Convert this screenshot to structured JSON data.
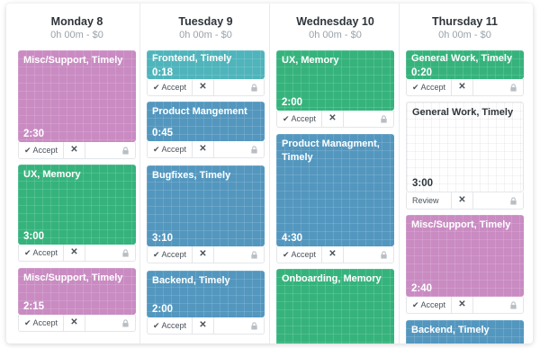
{
  "days": [
    {
      "title": "Monday 8",
      "summary": "0h 00m - $0",
      "entries": [
        {
          "label": "Misc/Support, Timely",
          "duration": "2:30",
          "color": "pink",
          "action": "Accept"
        },
        {
          "label": "UX, Memory",
          "duration": "3:00",
          "color": "green",
          "action": "Accept"
        },
        {
          "label": "Misc/Support, Timely",
          "duration": "2:15",
          "color": "pink",
          "action": "Accept"
        }
      ]
    },
    {
      "title": "Tuesday 9",
      "summary": "0h 00m - $0",
      "entries": [
        {
          "label": "Frontend, Timely",
          "duration": "0:18",
          "color": "teal",
          "action": "Accept"
        },
        {
          "label": "Product Mangement",
          "duration": "0:45",
          "color": "blue",
          "action": "Accept"
        },
        {
          "label": "Bugfixes, Timely",
          "duration": "3:10",
          "color": "blue",
          "action": "Accept"
        },
        {
          "label": "Backend, Timely",
          "duration": "2:00",
          "color": "blue",
          "action": "Accept"
        }
      ]
    },
    {
      "title": "Wednesday 10",
      "summary": "0h 00m - $0",
      "entries": [
        {
          "label": "UX, Memory",
          "duration": "2:00",
          "color": "green",
          "action": "Accept"
        },
        {
          "label": "Product Managment, Timely",
          "duration": "4:30",
          "color": "blue",
          "action": "Accept"
        },
        {
          "label": "Onboarding, Memory",
          "duration": "",
          "color": "green",
          "action": ""
        }
      ]
    },
    {
      "title": "Thursday 11",
      "summary": "0h 00m - $0",
      "entries": [
        {
          "label": "General Work, Timely",
          "duration": "0:20",
          "color": "green",
          "action": "Accept"
        },
        {
          "label": "General Work, Timely",
          "duration": "3:00",
          "color": "white",
          "action": "Review"
        },
        {
          "label": "Misc/Support, Timely",
          "duration": "2:40",
          "color": "pink",
          "action": "Accept"
        },
        {
          "label": "Backend, Timely",
          "duration": "",
          "color": "blue",
          "action": ""
        }
      ]
    }
  ],
  "colors": {
    "pink": "#c98bc2",
    "green": "#36b37c",
    "teal": "#4fb4bb",
    "blue": "#5397bf",
    "white": "#ffffff"
  },
  "icons": {
    "accept": "check-icon",
    "reject": "close-icon",
    "lock": "lock-icon"
  },
  "glyphs": {
    "check": "✔",
    "x": "✕"
  }
}
